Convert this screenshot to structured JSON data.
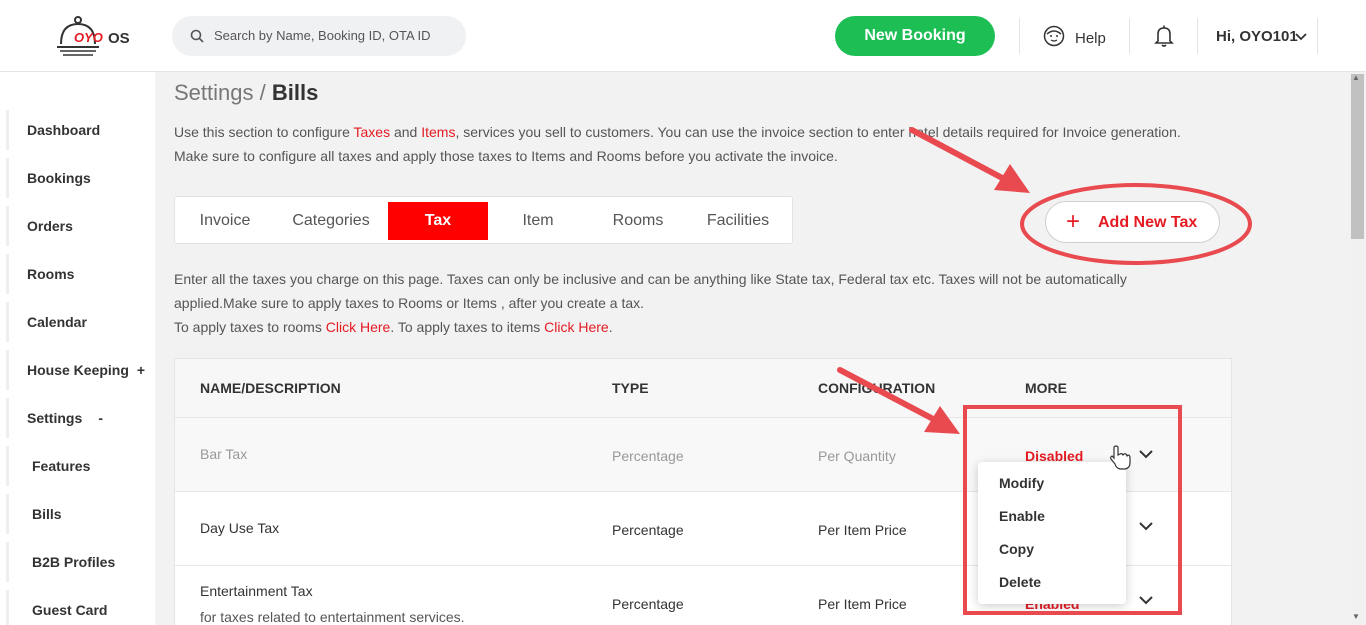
{
  "header": {
    "logo_brand": "OYO",
    "logo_suffix": "OS",
    "search_placeholder": "Search by Name, Booking ID, OTA ID",
    "new_booking": "New Booking",
    "help": "Help",
    "user": "Hi, OYO101"
  },
  "sidebar": {
    "items": [
      {
        "label": "Dashboard",
        "extra": ""
      },
      {
        "label": "Bookings",
        "extra": ""
      },
      {
        "label": "Orders",
        "extra": ""
      },
      {
        "label": "Rooms",
        "extra": ""
      },
      {
        "label": "Calendar",
        "extra": ""
      },
      {
        "label": "House Keeping",
        "extra": "+"
      },
      {
        "label": "Settings",
        "extra": "-"
      },
      {
        "label": "Features",
        "extra": ""
      },
      {
        "label": "Bills",
        "extra": ""
      },
      {
        "label": "B2B Profiles",
        "extra": ""
      },
      {
        "label": "Guest Card",
        "extra": ""
      }
    ]
  },
  "breadcrumb": {
    "parent": "Settings",
    "sep": " / ",
    "current": "Bills"
  },
  "intro": {
    "p1": "Use this section to configure ",
    "taxes": "Taxes",
    "and": " and ",
    "items": "Items",
    "p2": ", services you sell to customers. You can use the invoice section to enter hotel details required for Invoice generation. Make sure to configure all taxes and apply those taxes to Items and Rooms before you activate the invoice."
  },
  "tabs": [
    "Invoice",
    "Categories",
    "Tax",
    "Item",
    "Rooms",
    "Facilities"
  ],
  "active_tab": "Tax",
  "add_tax_button": "Add New Tax",
  "info": {
    "line1": "Enter all the taxes you charge on this page. Taxes can only be inclusive and can be anything like State tax, Federal tax etc. Taxes will not be automatically applied.Make sure to apply taxes to Rooms or Items , after you create a tax.",
    "rooms_prefix": "To apply taxes to rooms ",
    "rooms_link": "Click Here",
    "items_prefix": ". To apply taxes to items ",
    "items_link": "Click Here",
    "end": "."
  },
  "table": {
    "headers": [
      "NAME/DESCRIPTION",
      "TYPE",
      "CONFIGURATION",
      "MORE"
    ],
    "rows": [
      {
        "name": "Bar Tax",
        "description": "",
        "type": "Percentage",
        "config": "Per Quantity",
        "status": "Disabled"
      },
      {
        "name": "Day Use Tax",
        "description": "",
        "type": "Percentage",
        "config": "Per Item Price",
        "status": ""
      },
      {
        "name": "Entertainment Tax",
        "description": "for taxes related to entertainment services.",
        "type": "Percentage",
        "config": "Per Item Price",
        "status": "Enabled"
      }
    ]
  },
  "menu": [
    "Modify",
    "Enable",
    "Copy",
    "Delete"
  ],
  "colors": {
    "accent": "#e41b23",
    "green": "#1dbf55",
    "annotation": "#e84a4f"
  }
}
